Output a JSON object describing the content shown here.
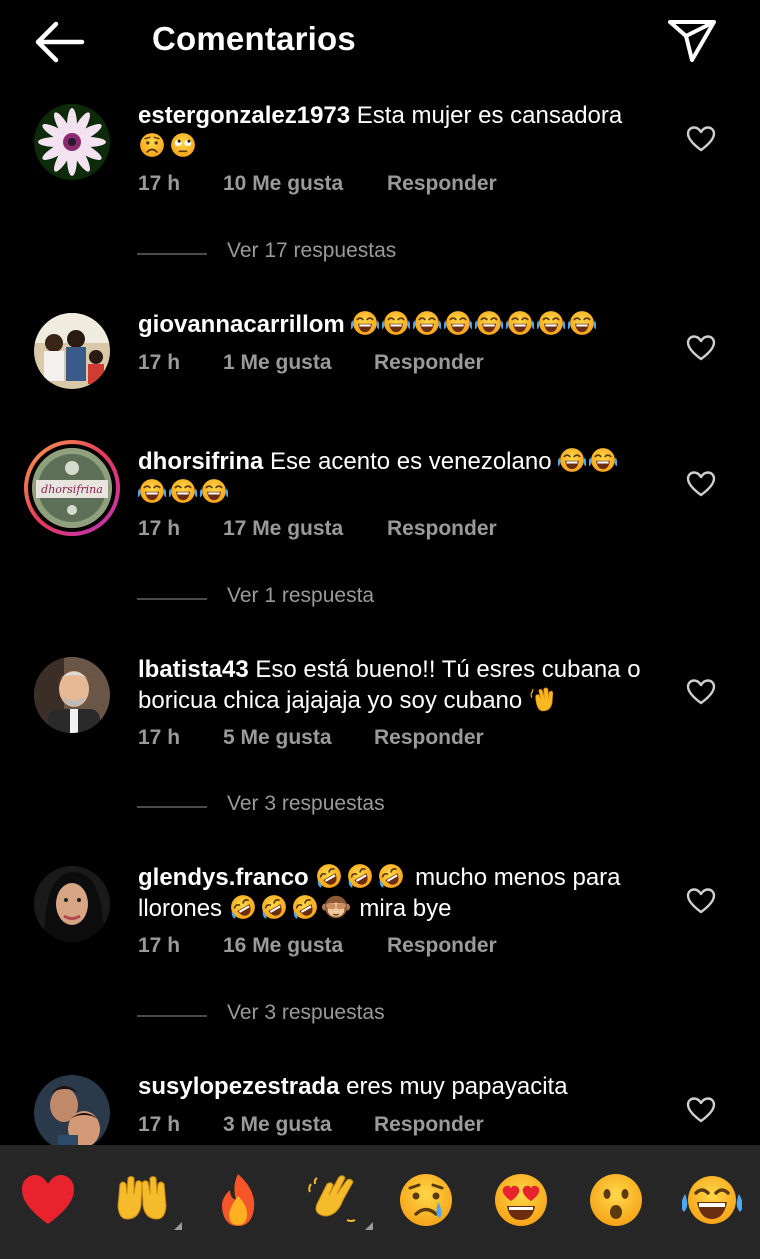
{
  "header": {
    "title": "Comentarios"
  },
  "comments": [
    {
      "username": "estergonzalez1973",
      "text": "Esta mujer es cansadora",
      "emojis": [
        "worried-face",
        "rolling-eyes-face"
      ],
      "time": "17 h",
      "likes": "10 Me gusta",
      "reply": "Responder",
      "view_replies": "Ver 17 respuestas"
    },
    {
      "username": "giovannacarrillom",
      "text": "",
      "emojis": [
        "joy",
        "joy",
        "joy",
        "joy",
        "joy",
        "joy",
        "joy",
        "joy"
      ],
      "time": "17 h",
      "likes": "1 Me gusta",
      "reply": "Responder"
    },
    {
      "username": "dhorsifrina",
      "text": "Ese acento es venezolano",
      "emojis": [
        "joy",
        "joy",
        "joy",
        "joy",
        "joy"
      ],
      "time": "17 h",
      "likes": "17 Me gusta",
      "reply": "Responder",
      "view_replies": "Ver 1 respuesta",
      "avatar_text": "dhorsifrina"
    },
    {
      "username": "lbatista43",
      "text_line1": "Eso está bueno!! Tú esres cubana o",
      "text_line2": "boricua chica jajajaja yo soy cubano",
      "emojis": [
        "waving-hand"
      ],
      "time": "17 h",
      "likes": "5 Me gusta",
      "reply": "Responder",
      "view_replies": "Ver 3 respuestas"
    },
    {
      "username": "glendys.franco",
      "text_part1": "mucho menos para",
      "text_part2": "llorones",
      "text_part3": "mira bye",
      "emojis": [
        "rofl",
        "rofl",
        "rofl",
        "rofl",
        "rofl",
        "rofl",
        "see-no-evil-monkey"
      ],
      "time": "17 h",
      "likes": "16 Me gusta",
      "reply": "Responder",
      "view_replies": "Ver 3 respuestas"
    },
    {
      "username": "susylopezestrada",
      "text": "eres muy papayacita",
      "time": "17 h",
      "likes": "3 Me gusta",
      "reply": "Responder"
    }
  ],
  "emoji_bar": [
    "red-heart",
    "raising-hands",
    "fire",
    "clapping-hands",
    "sad-face",
    "heart-eyes",
    "surprised-face",
    "joy"
  ],
  "colors": {
    "background": "#000000",
    "secondary_text": "#9a9a9a",
    "emoji_bar_bg": "#262626"
  }
}
